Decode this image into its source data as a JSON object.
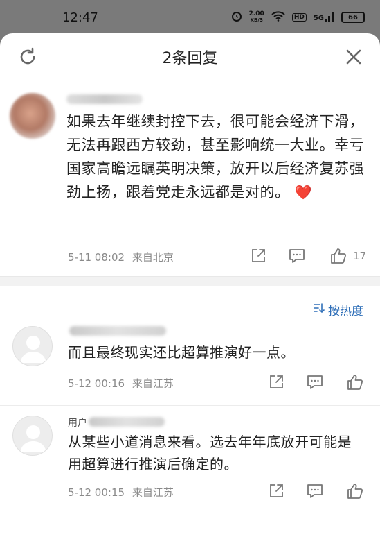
{
  "status_bar": {
    "time": "12:47",
    "speed_value": "2.00",
    "speed_unit": "KB/S",
    "hd": "HD",
    "network": "5G",
    "battery": "66"
  },
  "sheet": {
    "title": "2条回复"
  },
  "main_comment": {
    "text": "如果去年继续封控下去，很可能会经济下滑，无法再跟西方较劲，甚至影响统一大业。幸亏国家高瞻远瞩英明决策，放开以后经济复苏强劲上扬，跟着党走永远都是对的。",
    "emoji": "❤️",
    "time": "5-11 08:02",
    "location": "来自北京",
    "likes": "17"
  },
  "sort": {
    "label": "按热度"
  },
  "replies": [
    {
      "text": "而且最终现实还比超算推演好一点。",
      "time": "5-12 00:16",
      "location": "来自江苏"
    },
    {
      "name_prefix": "用户",
      "text": "从某些小道消息来看。选去年年底放开可能是用超算进行推演后确定的。",
      "time": "5-12 00:15",
      "location": "来自江苏"
    }
  ],
  "colors": {
    "accent": "#2f6fb8",
    "meta": "#8a8a8a",
    "heart": "#e53935"
  }
}
